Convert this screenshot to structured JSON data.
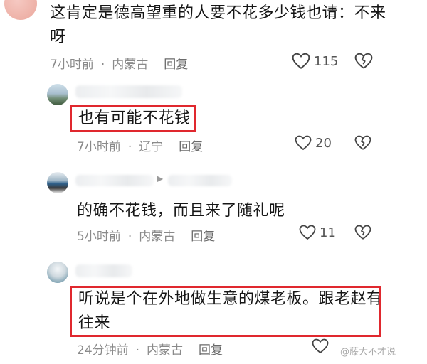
{
  "top_comment": {
    "text_line1": "这肯定是德高望重的人要不花多少钱也请：不来",
    "text_line2": "呀",
    "time": "7小时前",
    "location": "内蒙古",
    "reply_label": "回复",
    "likes": "115"
  },
  "reply1": {
    "text": "也有可能不花钱",
    "time": "7小时前",
    "location": "辽宁",
    "reply_label": "回复",
    "likes": "20"
  },
  "reply2": {
    "text": "的确不花钱，而且来了随礼呢",
    "time": "5小时前",
    "location": "内蒙古",
    "reply_label": "回复",
    "likes": "11"
  },
  "reply3": {
    "text_line1": "听说是个在外地做生意的煤老板。跟老赵有",
    "text_line2": "往来",
    "time": "24分钟前",
    "location": "内蒙古",
    "reply_label": "回复"
  },
  "separator": "·",
  "watermark": "@藤大不才说",
  "colors": {
    "highlight": "#e0282e",
    "meta": "#8a8a8a"
  }
}
